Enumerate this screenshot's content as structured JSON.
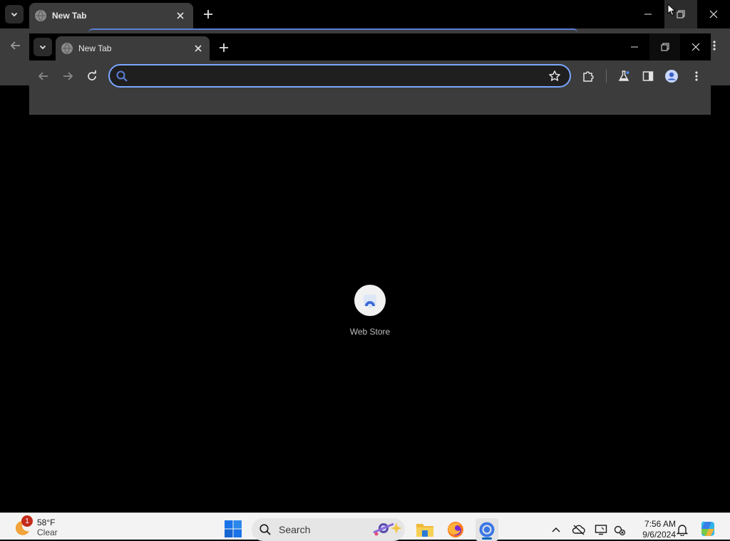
{
  "outer_browser": {
    "tab_title": "New Tab"
  },
  "inner_browser": {
    "tab_title": "New Tab",
    "omnibox": {
      "value": "",
      "placeholder": ""
    }
  },
  "new_tab_page": {
    "shortcuts": [
      {
        "label": "Web Store"
      }
    ]
  },
  "taskbar": {
    "weather": {
      "temperature": "58°F",
      "condition": "Clear",
      "badge": "1"
    },
    "search_label": "Search",
    "clock": {
      "time": "7:56 AM",
      "date": "9/6/2024"
    }
  },
  "colors": {
    "omnibox_focus": "#7aa7ff",
    "toolbar": "#3c3c3c",
    "taskbar": "#f3f3f3",
    "notification_badge": "#c42b1c"
  }
}
